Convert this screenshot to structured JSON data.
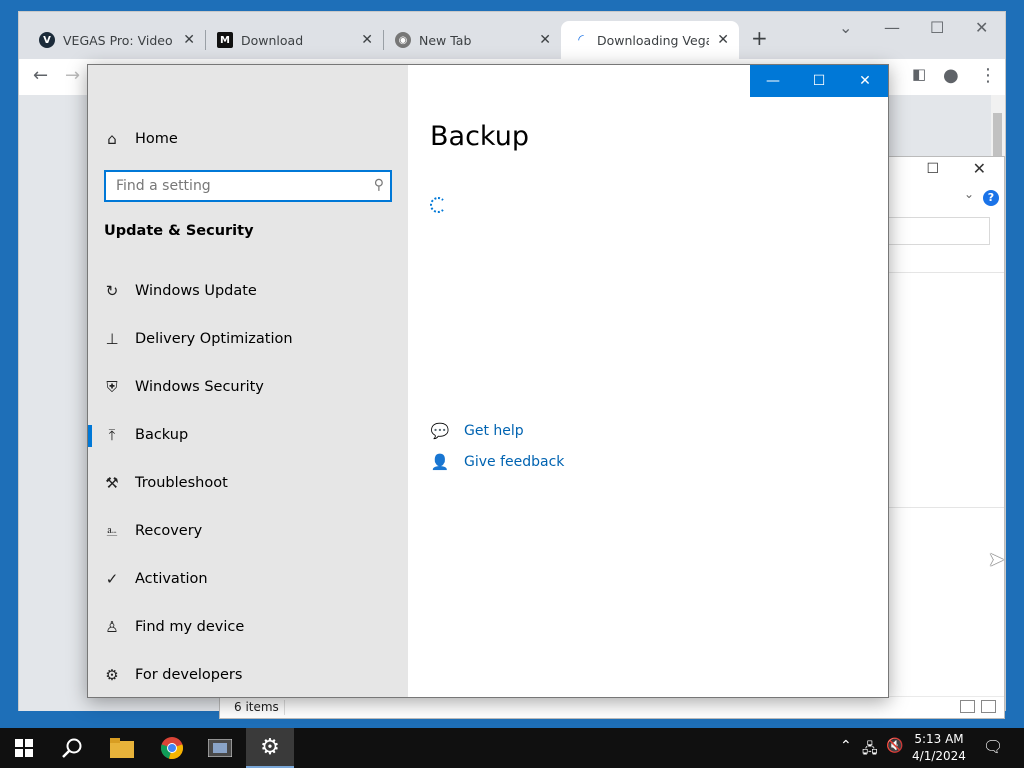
{
  "browser": {
    "tabs": [
      {
        "label": "VEGAS Pro: Video Edi",
        "icon": "vegas-icon"
      },
      {
        "label": "Download",
        "icon": "m-logo-icon"
      },
      {
        "label": "New Tab",
        "icon": "chrome-icon"
      },
      {
        "label": "Downloading Vegas P",
        "icon": "loading-icon",
        "active": true
      }
    ]
  },
  "settings": {
    "home_label": "Home",
    "search_placeholder": "Find a setting",
    "section_title": "Update & Security",
    "nav_items": [
      {
        "label": "Windows Update",
        "icon": "refresh-icon"
      },
      {
        "label": "Delivery Optimization",
        "icon": "delivery-optimization-icon"
      },
      {
        "label": "Windows Security",
        "icon": "shield-icon"
      },
      {
        "label": "Backup",
        "icon": "backup-arrow-icon",
        "selected": true
      },
      {
        "label": "Troubleshoot",
        "icon": "wrench-icon"
      },
      {
        "label": "Recovery",
        "icon": "recovery-icon"
      },
      {
        "label": "Activation",
        "icon": "check-circle-icon"
      },
      {
        "label": "Find my device",
        "icon": "person-pin-icon"
      },
      {
        "label": "For developers",
        "icon": "developer-tools-icon"
      }
    ],
    "page_title": "Backup",
    "get_help_label": "Get help",
    "give_feedback_label": "Give feedback",
    "accent_color": "#0078d7"
  },
  "explorer": {
    "status_text": "6 items"
  },
  "taskbar": {
    "time": "5:13 AM",
    "date": "4/1/2024"
  }
}
